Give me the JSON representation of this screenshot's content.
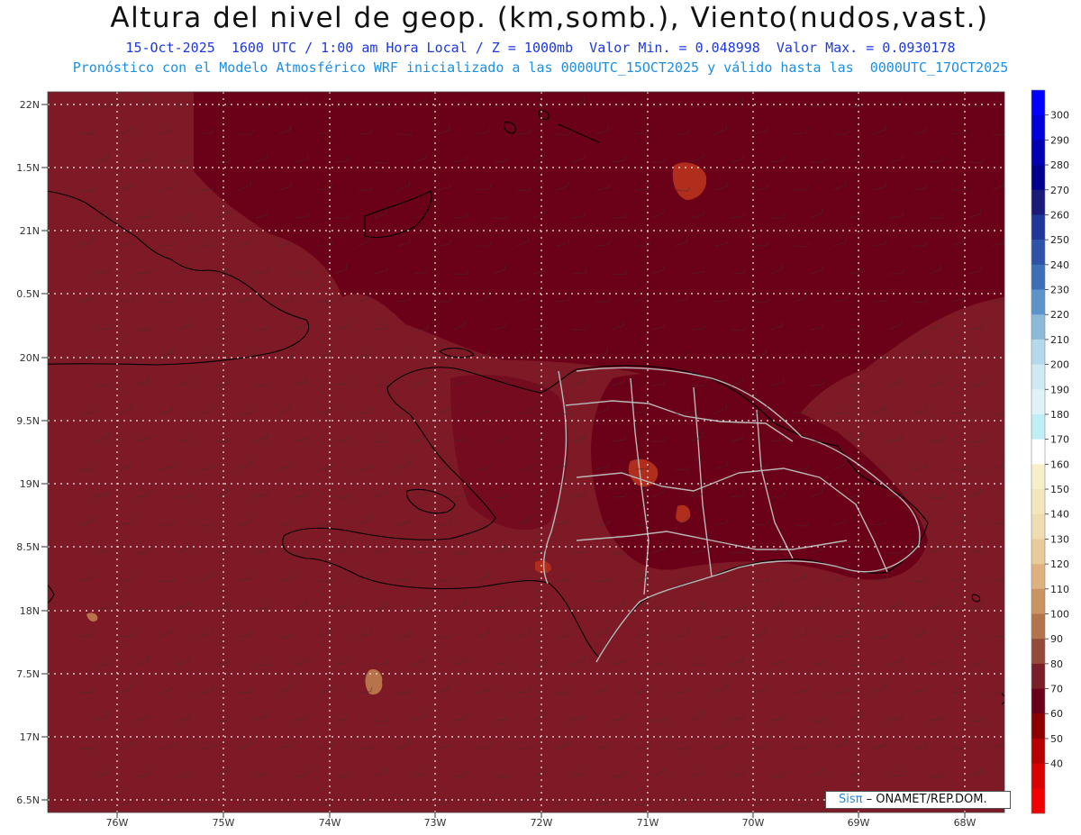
{
  "title": "Altura del nivel de geop. (km,somb.), Viento(nudos,vast.)",
  "subtitle_1": "15-Oct-2025  1600 UTC / 1:00 am Hora Local / Z = 1000mb  Valor Min. = 0.048998  Valor Max. = 0.0930178",
  "subtitle_2": "Pronóstico con el Modelo Atmosférico WRF inicializado a las 0000UTC_15OCT2025 y válido hasta las  0000UTC_17OCT2025",
  "lat_labels": [
    "22N",
    "1.5N",
    "21N",
    "0.5N",
    "20N",
    "9.5N",
    "19N",
    "8.5N",
    "18N",
    "7.5N",
    "17N",
    "6.5N"
  ],
  "lon_labels": [
    "76W",
    "75W",
    "74W",
    "73W",
    "72W",
    "71W",
    "70W",
    "69W",
    "68W"
  ],
  "colorbar": {
    "labels": [
      "300",
      "290",
      "280",
      "270",
      "260",
      "250",
      "240",
      "230",
      "220",
      "210",
      "200",
      "190",
      "180",
      "170",
      "160",
      "150",
      "140",
      "130",
      "120",
      "110",
      "100",
      "90",
      "80",
      "70",
      "60",
      "50",
      "40"
    ],
    "colors": [
      "#0000ff",
      "#0000d8",
      "#0000b2",
      "#00008c",
      "#1a1a7a",
      "#1e3799",
      "#2d52a8",
      "#3c6fb6",
      "#5b94c8",
      "#8bbad9",
      "#b4d9ea",
      "#cfe9f3",
      "#dff2f8",
      "#c0eef6",
      "#ffffff",
      "#f7efc8",
      "#f3e6bd",
      "#efdcb0",
      "#e8cb98",
      "#deb27e",
      "#c99362",
      "#b3734b",
      "#944b3a",
      "#7a1f29",
      "#68001a",
      "#8b0000",
      "#b50000",
      "#d80000",
      "#f00000"
    ]
  },
  "field_colors": {
    "sea": "#7e1a26",
    "high": "#6b0019",
    "peak": "#b12e1c",
    "low": "#b9734a"
  },
  "credit": {
    "logo": "Sisπ",
    "text": " – ONAMET/REP.DOM."
  }
}
